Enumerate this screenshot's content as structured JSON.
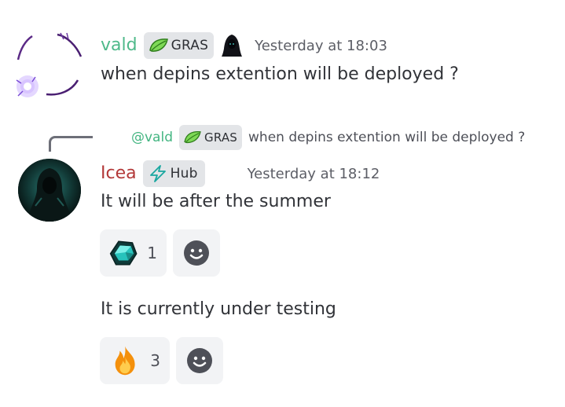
{
  "messages": [
    {
      "author": "vald",
      "author_color": "#4fb98a",
      "tag": "GRAS",
      "timestamp": "Yesterday at 18:03",
      "text": "when depins extention will be deployed ?"
    },
    {
      "reply": {
        "mention": "@vald",
        "tag": "GRAS",
        "text": "when depins extention will be deployed ?"
      },
      "author": "Icea",
      "author_color": "#b33939",
      "tag": "Hub",
      "timestamp": "Yesterday at 18:12",
      "text": "It will be after the summer",
      "reaction_count": "1"
    },
    {
      "text": "It is currently under testing",
      "reaction_count": "3"
    }
  ],
  "icons": [
    "leaf-icon",
    "hooded-figure-icon",
    "lightning-icon",
    "crystal-emoji",
    "fire-emoji",
    "smiley-add-reaction-icon"
  ]
}
